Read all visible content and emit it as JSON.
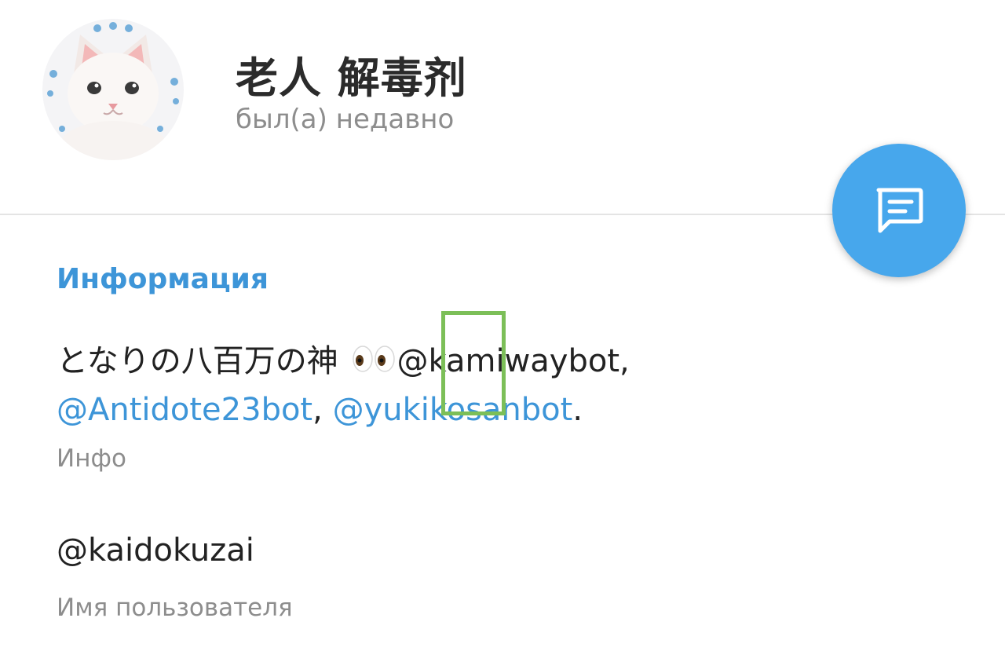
{
  "profile": {
    "name": "老人 解毒剂",
    "status": "был(а) недавно",
    "avatar_icon": "cat-avatar"
  },
  "fab": {
    "icon": "message-icon",
    "color": "#47a7ec"
  },
  "info": {
    "section_title": "Информация",
    "bio": {
      "text_before": "となりの八百万の神",
      "emoji": "eyes-emoji",
      "mention_1": "@kamiwaybot",
      "sep_1": ",",
      "mention_2": "@Antidote23bot",
      "sep_2": ", ",
      "mention_3": "@yukikosanbot",
      "end": "."
    },
    "bio_caption": "Инфо",
    "username": "@kaidokuzai",
    "username_caption": "Имя пользователя"
  },
  "colors": {
    "accent": "#3d95d8",
    "highlight": "#7cbf58"
  }
}
